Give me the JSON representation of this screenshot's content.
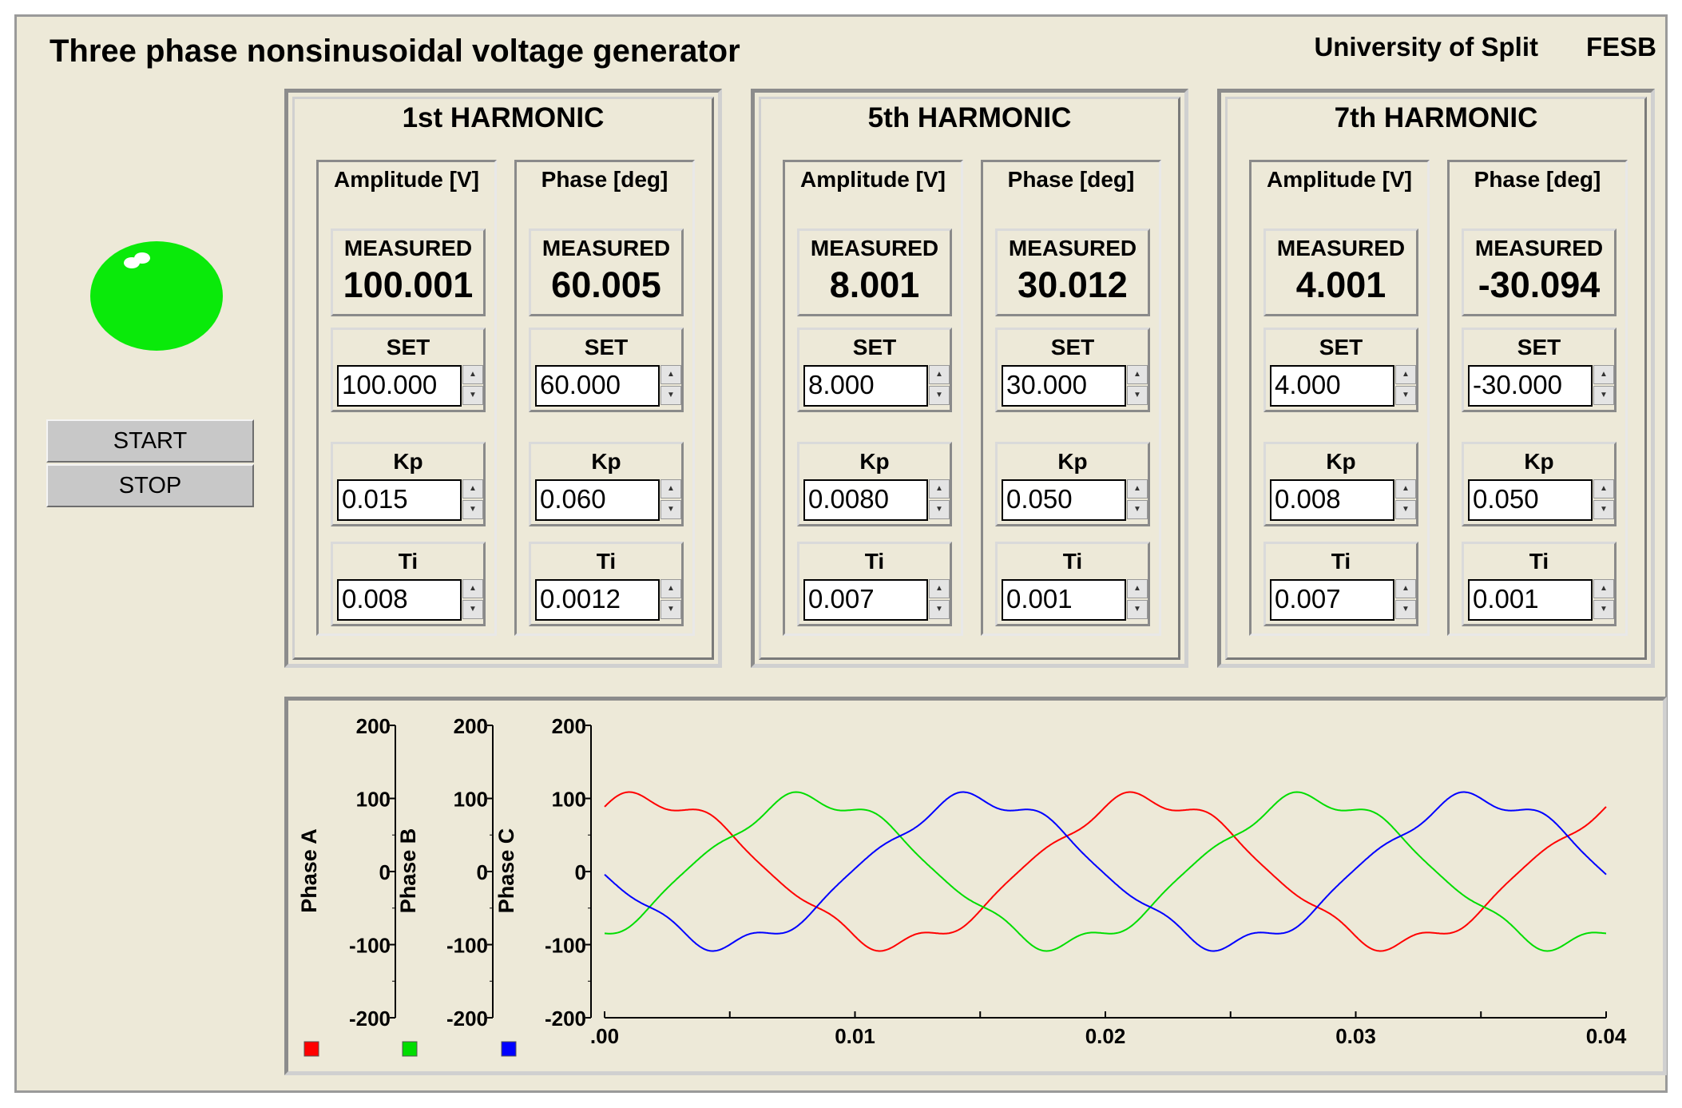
{
  "app": {
    "title": "Three phase nonsinusoidal voltage generator",
    "university": "University of Split",
    "faculty": "FESB"
  },
  "indicator": {
    "state": "on",
    "color": "#0aea0a"
  },
  "buttons": {
    "start": "START",
    "stop": "STOP"
  },
  "column_titles": {
    "amplitude": "Amplitude [V]",
    "phase": "Phase [deg]"
  },
  "labels": {
    "measured": "MEASURED",
    "set": "SET",
    "kp": "Kp",
    "ti": "Ti"
  },
  "harmonics": [
    {
      "title": "1st HARMONIC",
      "amplitude": {
        "measured": "100.001",
        "set": "100.000",
        "kp": "0.015",
        "ti": "0.008"
      },
      "phase": {
        "measured": "60.005",
        "set": "60.000",
        "kp": "0.060",
        "ti": "0.0012"
      }
    },
    {
      "title": "5th HARMONIC",
      "amplitude": {
        "measured": "8.001",
        "set": "8.000",
        "kp": "0.0080",
        "ti": "0.007"
      },
      "phase": {
        "measured": "30.012",
        "set": "30.000",
        "kp": "0.050",
        "ti": "0.001"
      }
    },
    {
      "title": "7th HARMONIC",
      "amplitude": {
        "measured": "4.001",
        "set": "4.000",
        "kp": "0.008",
        "ti": "0.007"
      },
      "phase": {
        "measured": "-30.094",
        "set": "-30.000",
        "kp": "0.050",
        "ti": "0.001"
      }
    }
  ],
  "chart_data": {
    "type": "line",
    "x_ticks": [
      ".00",
      "0.01",
      "0.02",
      "0.03",
      "0.04"
    ],
    "x_range": [
      0,
      0.04
    ],
    "y_range": [
      -200,
      200
    ],
    "y_ticks": [
      "200",
      "100",
      "0",
      "-100",
      "-200"
    ],
    "axes": [
      {
        "label": "Phase A",
        "color": "#ff0000"
      },
      {
        "label": "Phase B",
        "color": "#00dd00"
      },
      {
        "label": "Phase C",
        "color": "#0000ff"
      }
    ],
    "frequency_hz": 50,
    "series": [
      {
        "name": "Phase A",
        "color": "#ff0000",
        "phase_shift_deg": 0
      },
      {
        "name": "Phase B",
        "color": "#00dd00",
        "phase_shift_deg": -120
      },
      {
        "name": "Phase C",
        "color": "#0000ff",
        "phase_shift_deg": 120
      }
    ]
  }
}
